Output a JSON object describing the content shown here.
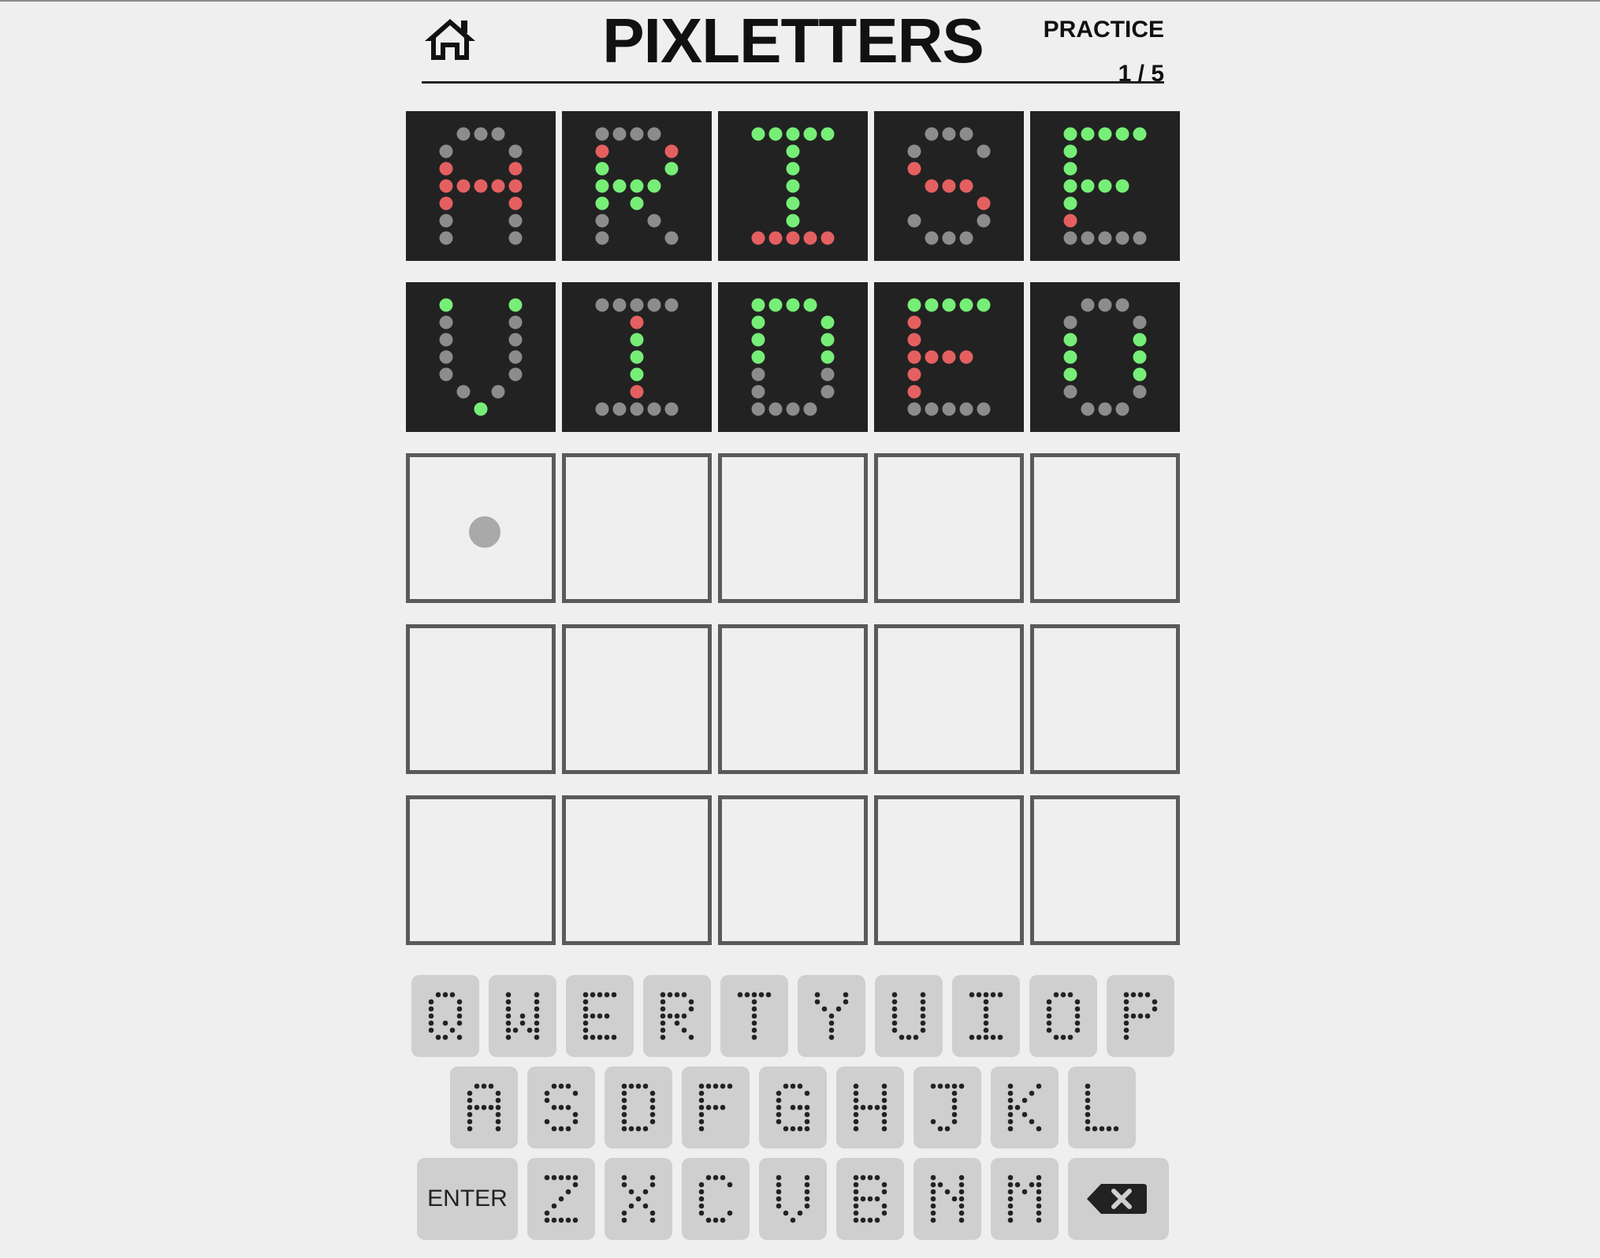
{
  "header": {
    "title": "PIXLETTERS",
    "mode": "PRACTICE",
    "progress": "1 / 5",
    "home_icon": "house-icon"
  },
  "colors": {
    "tile_bg": "#222222",
    "dot_gray": "#8c8c8c",
    "dot_green": "#77ee77",
    "dot_red": "#e46060",
    "key_bg": "#cfcfcf"
  },
  "board": {
    "rows": [
      {
        "letters": [
          "A",
          "R",
          "I",
          "S",
          "E"
        ],
        "lit": [
          [
            0,
            0,
            1,
            1,
            1,
            0,
            0
          ],
          [
            0,
            1,
            1,
            1,
            1,
            1,
            0
          ],
          [
            1,
            1,
            1,
            1,
            1,
            1,
            1
          ],
          [
            0,
            0,
            1,
            1,
            1,
            0,
            0
          ],
          [
            1,
            1,
            1,
            1,
            1,
            1,
            0
          ]
        ],
        "status": [
          [
            0,
            0,
            2,
            2,
            2,
            0,
            0
          ],
          [
            0,
            2,
            1,
            1,
            1,
            0,
            0
          ],
          [
            1,
            1,
            1,
            1,
            1,
            1,
            2
          ],
          [
            0,
            0,
            2,
            2,
            2,
            0,
            0
          ],
          [
            1,
            1,
            1,
            1,
            1,
            2,
            0
          ]
        ]
      },
      {
        "letters": [
          "V",
          "I",
          "D",
          "E",
          "O"
        ],
        "lit": [
          [
            1,
            0,
            0,
            0,
            0,
            0,
            1
          ],
          [
            0,
            1,
            1,
            1,
            1,
            1,
            0
          ],
          [
            1,
            1,
            1,
            1,
            0,
            0,
            0
          ],
          [
            1,
            1,
            1,
            1,
            1,
            1,
            0
          ],
          [
            0,
            0,
            1,
            1,
            1,
            0,
            0
          ]
        ],
        "status": [
          [
            1,
            0,
            0,
            0,
            0,
            0,
            1
          ],
          [
            0,
            2,
            1,
            1,
            1,
            2,
            0
          ],
          [
            1,
            1,
            1,
            1,
            0,
            0,
            0
          ],
          [
            1,
            2,
            2,
            2,
            2,
            2,
            0
          ],
          [
            0,
            0,
            1,
            1,
            1,
            0,
            0
          ]
        ]
      }
    ],
    "total_rows": 5,
    "cursor": {
      "row": 2,
      "col": 0
    }
  },
  "keyboard": {
    "rows": [
      [
        "Q",
        "W",
        "E",
        "R",
        "T",
        "Y",
        "U",
        "I",
        "O",
        "P"
      ],
      [
        "A",
        "S",
        "D",
        "F",
        "G",
        "H",
        "J",
        "K",
        "L"
      ],
      [
        "ENTER",
        "Z",
        "X",
        "C",
        "V",
        "B",
        "N",
        "M",
        "BACKSPACE"
      ]
    ],
    "enter_label": "ENTER",
    "backspace_icon": "backspace-icon"
  }
}
